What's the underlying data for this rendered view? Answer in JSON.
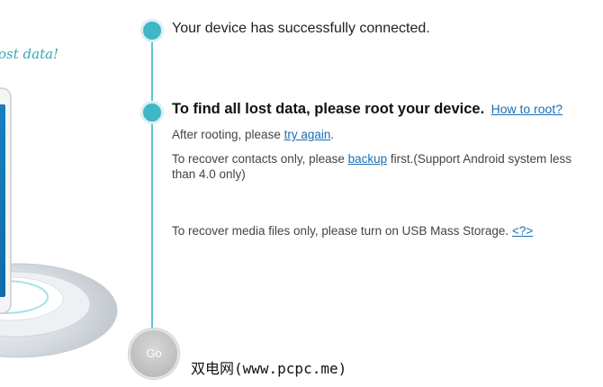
{
  "tagline": "ost data!",
  "steps": {
    "connected": "Your device has successfully connected.",
    "root_heading": "To find all lost data, please root your device.",
    "how_to_root_link": "How to root?"
  },
  "after_rooting": {
    "prefix": "After rooting, please ",
    "link": "try again",
    "suffix": "."
  },
  "recover_contacts": {
    "prefix": "To recover contacts only, please ",
    "link": "backup",
    "suffix": " first.(Support Android system less than 4.0 only)"
  },
  "recover_media": {
    "prefix": "To recover media files only, please turn on USB Mass Storage. ",
    "link": "<?>"
  },
  "go_button": "Go",
  "watermark": "双电网(www.pcpc.me)",
  "colors": {
    "accent": "#41b6c4",
    "link": "#1a6fb3",
    "go_button": "#bdbdbd"
  }
}
